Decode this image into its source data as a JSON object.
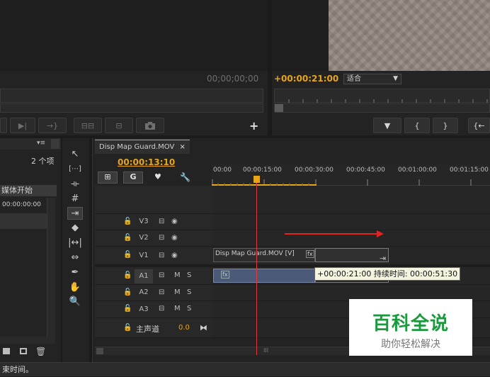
{
  "source_monitor": {
    "timecode": "00;00;00;00",
    "add_label": "+",
    "buttons": [
      "▶|",
      "→}",
      "⊟⊟",
      "⊟",
      "📷"
    ]
  },
  "program_monitor": {
    "timecode": "+00:00:21:00",
    "zoom_select": "适合",
    "buttons": [
      "▼",
      "{",
      "}",
      "{←"
    ]
  },
  "project": {
    "menu": "▾≡",
    "count": "2 个项",
    "column_header": "媒体开始",
    "row_value": "00:00:00:00"
  },
  "timeline": {
    "tab_title": "Disp Map Guard.MOV",
    "tab_close": "×",
    "playhead_timecode": "00:00:13:10",
    "ruler_labels": [
      "00:00",
      "00:00:15:00",
      "00:00:30:00",
      "00:00:45:00",
      "00:01:00:00",
      "00:01:15:00"
    ],
    "video_tracks": [
      {
        "name": "V3"
      },
      {
        "name": "V2"
      },
      {
        "name": "V1"
      }
    ],
    "audio_tracks": [
      {
        "name": "A1",
        "m": "M",
        "s": "S"
      },
      {
        "name": "A2",
        "m": "M",
        "s": "S"
      },
      {
        "name": "A3",
        "m": "M",
        "s": "S"
      }
    ],
    "master": {
      "name": "主声道",
      "value": "0.0"
    },
    "video_clip_label": "Disp Map Guard.MOV [V]",
    "fx_label": "fx",
    "tooltip": "+00:00:21:00 持续时间: 00:00:51:30",
    "scroll_label": "III"
  },
  "status_bar": "束时间。",
  "watermark": {
    "title": "百科全说",
    "subtitle": "助你轻松解决"
  },
  "colors": {
    "accent": "#e8a51a",
    "playhead": "#e23a3a",
    "arrow": "#e02424",
    "clip_blue": "#4a5a78",
    "watermark_green": "#1a9a3c"
  }
}
